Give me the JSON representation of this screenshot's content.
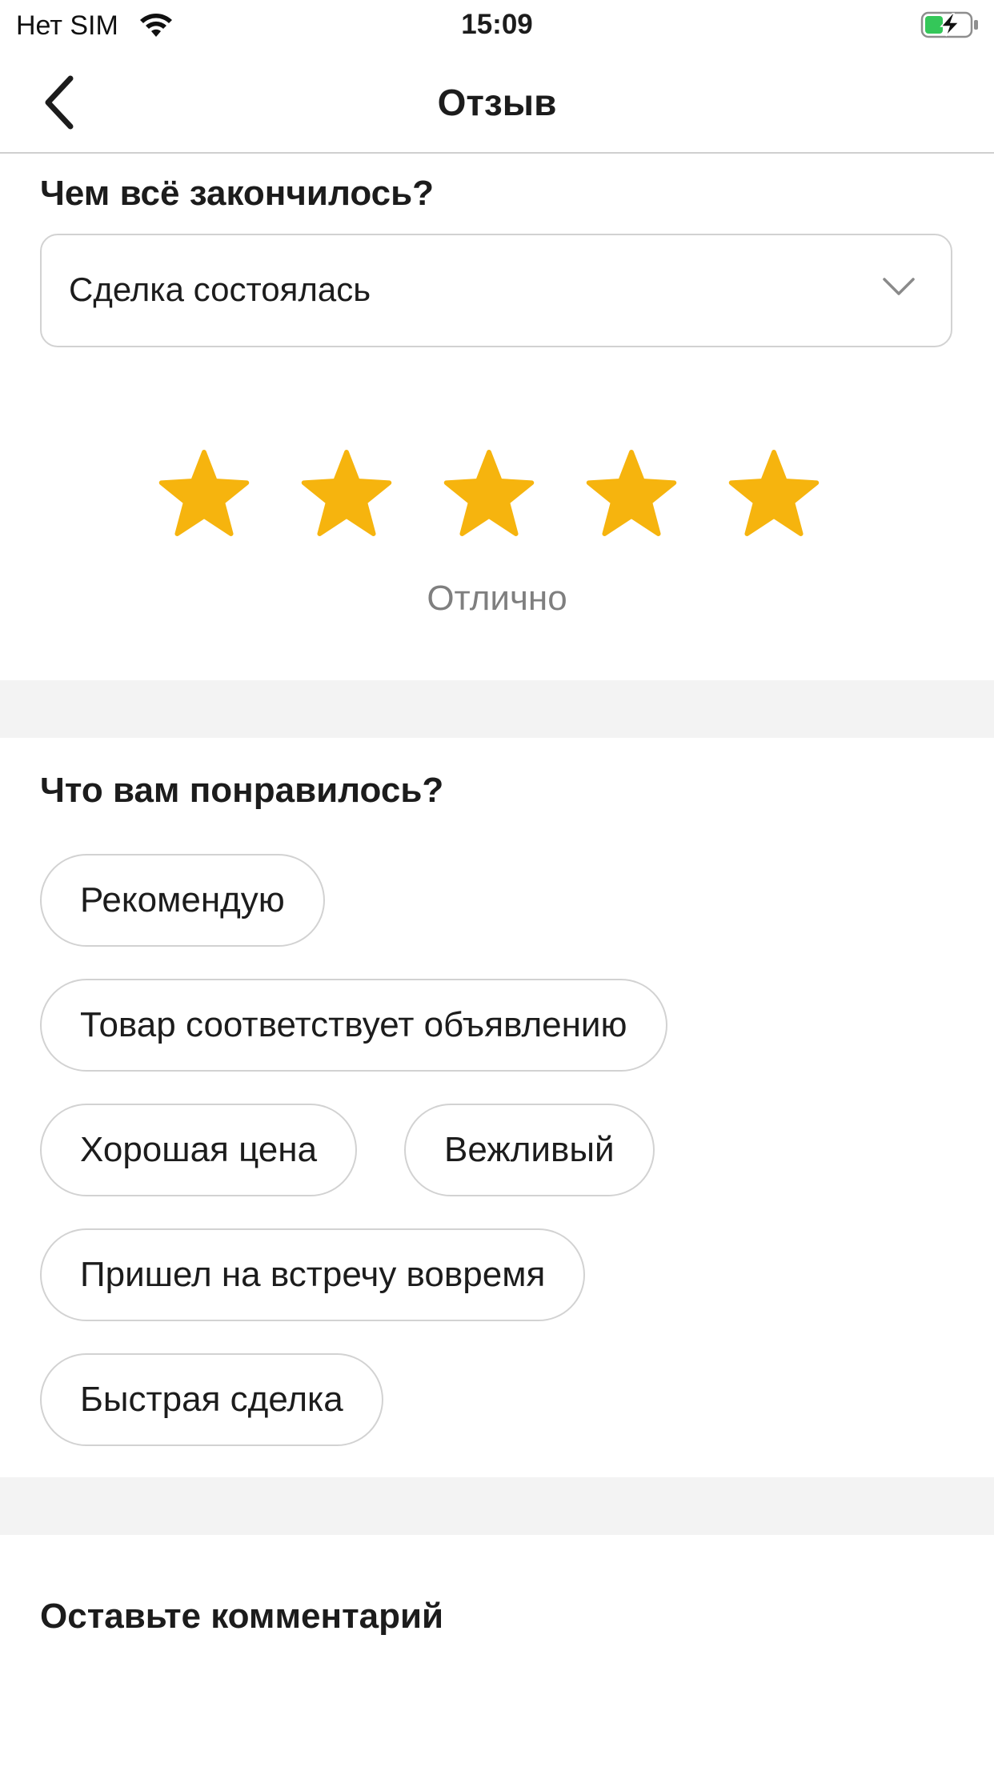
{
  "status_bar": {
    "carrier": "Нет SIM",
    "time": "15:09",
    "wifi_icon": "wifi-icon",
    "battery_icon": "battery-charging-icon",
    "battery_color": "#34c759"
  },
  "nav": {
    "title": "Отзыв",
    "back_icon": "chevron-left-icon"
  },
  "outcome": {
    "question": "Чем всё закончилось?",
    "selected": "Сделка состоялась",
    "dropdown_icon": "chevron-down-icon"
  },
  "rating": {
    "stars_filled": 5,
    "stars_total": 5,
    "star_color": "#f6b40e",
    "label": "Отлично"
  },
  "liked": {
    "question": "Что вам понравилось?",
    "chips": [
      "Рекомендую",
      "Товар соответствует объявлению",
      "Хорошая цена",
      "Вежливый",
      "Пришел на встречу вовремя",
      "Быстрая сделка"
    ]
  },
  "comment": {
    "title": "Оставьте комментарий"
  },
  "colors": {
    "divider_band": "#f3f3f3",
    "border": "#d2d2d2",
    "muted_text": "#7f7f7f"
  }
}
